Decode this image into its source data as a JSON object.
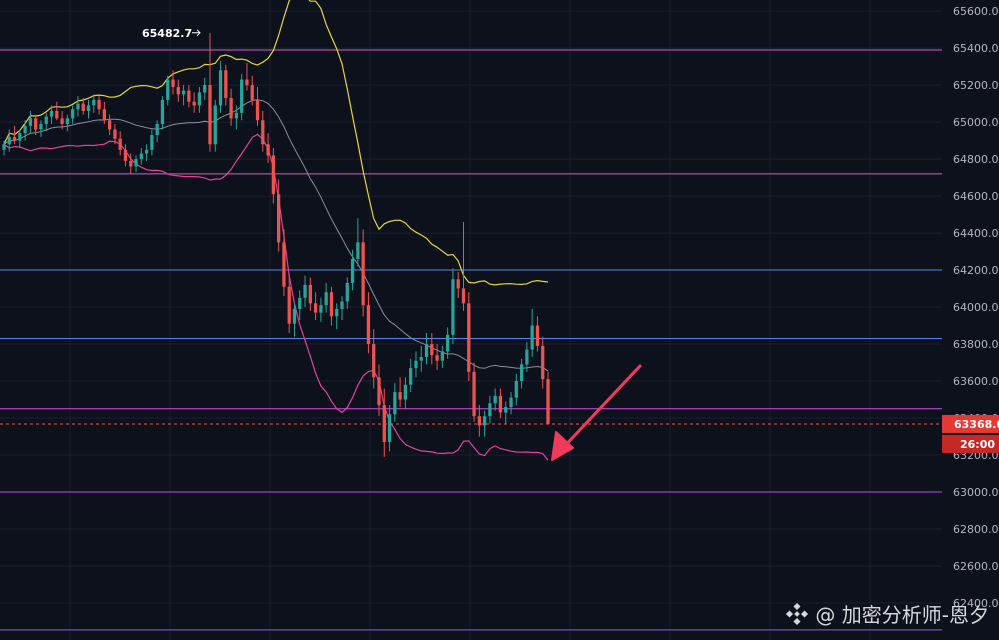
{
  "chart_data": {
    "type": "candlestick",
    "title": "",
    "ylim": [
      62200,
      65660
    ],
    "y_ticks": [
      "62400.0",
      "62600.0",
      "62800.0",
      "63000.0",
      "63200.0",
      "63400.0",
      "63600.0",
      "63800.0",
      "64000.0",
      "64200.0",
      "64400.0",
      "64600.0",
      "64800.0",
      "65000.0",
      "65200.0",
      "65400.0",
      "65600.0"
    ],
    "high_marker": {
      "label": "65482.7",
      "value": 65482.7
    },
    "last_price": {
      "label": "63368.0",
      "value": 63368.0
    },
    "countdown": "26:00",
    "levels": [
      {
        "value": 65390,
        "color": "#e256c8"
      },
      {
        "value": 64720,
        "color": "#e256c8"
      },
      {
        "value": 64200,
        "color": "#4f86f7"
      },
      {
        "value": 63830,
        "color": "#4f86f7"
      },
      {
        "value": 63450,
        "color": "#d24fe0"
      },
      {
        "value": 63000,
        "color": "#b94cf0"
      },
      {
        "value": 62255,
        "color": "#8b5cf6"
      }
    ],
    "candles": [
      [
        64850,
        64900,
        64820,
        64880
      ],
      [
        64880,
        64960,
        64840,
        64920
      ],
      [
        64920,
        64980,
        64880,
        64900
      ],
      [
        64900,
        64960,
        64860,
        64940
      ],
      [
        64940,
        65010,
        64900,
        64980
      ],
      [
        64980,
        65060,
        64940,
        65020
      ],
      [
        65020,
        65040,
        64930,
        64960
      ],
      [
        64960,
        65010,
        64920,
        64990
      ],
      [
        64990,
        65050,
        64950,
        65030
      ],
      [
        65030,
        65090,
        64990,
        65060
      ],
      [
        65060,
        65110,
        65010,
        65020
      ],
      [
        65020,
        65060,
        64960,
        64990
      ],
      [
        64990,
        65040,
        64950,
        65020
      ],
      [
        65020,
        65090,
        64990,
        65070
      ],
      [
        65070,
        65140,
        65030,
        65100
      ],
      [
        65100,
        65130,
        65040,
        65060
      ],
      [
        65060,
        65120,
        65020,
        65090
      ],
      [
        65090,
        65150,
        65050,
        65120
      ],
      [
        65120,
        65140,
        65040,
        65070
      ],
      [
        65070,
        65110,
        64990,
        65010
      ],
      [
        65010,
        65040,
        64930,
        64960
      ],
      [
        64960,
        64990,
        64880,
        64910
      ],
      [
        64910,
        64950,
        64820,
        64850
      ],
      [
        64850,
        64880,
        64760,
        64790
      ],
      [
        64790,
        64830,
        64720,
        64760
      ],
      [
        64760,
        64820,
        64730,
        64800
      ],
      [
        64800,
        64860,
        64770,
        64830
      ],
      [
        64830,
        64880,
        64790,
        64850
      ],
      [
        64850,
        64960,
        64820,
        64930
      ],
      [
        64930,
        65010,
        64890,
        64990
      ],
      [
        64990,
        65140,
        64960,
        65120
      ],
      [
        65120,
        65250,
        65090,
        65230
      ],
      [
        65230,
        65280,
        65150,
        65190
      ],
      [
        65190,
        65230,
        65110,
        65150
      ],
      [
        65150,
        65200,
        65090,
        65170
      ],
      [
        65170,
        65200,
        65080,
        65110
      ],
      [
        65110,
        65160,
        65050,
        65090
      ],
      [
        65090,
        65190,
        65050,
        65160
      ],
      [
        65160,
        65240,
        65120,
        65200
      ],
      [
        65200,
        65482,
        64840,
        64880
      ],
      [
        64880,
        65120,
        64840,
        65090
      ],
      [
        65090,
        65330,
        65050,
        65280
      ],
      [
        65280,
        65310,
        65090,
        65130
      ],
      [
        65130,
        65180,
        64980,
        65020
      ],
      [
        65020,
        65090,
        64960,
        65050
      ],
      [
        65050,
        65260,
        65010,
        65230
      ],
      [
        65230,
        65320,
        65170,
        65200
      ],
      [
        65200,
        65250,
        65090,
        65120
      ],
      [
        65120,
        65190,
        64980,
        65010
      ],
      [
        65010,
        65060,
        64840,
        64880
      ],
      [
        64880,
        64940,
        64780,
        64820
      ],
      [
        64820,
        64860,
        64560,
        64610
      ],
      [
        64610,
        64690,
        64300,
        64350
      ],
      [
        64350,
        64420,
        64060,
        64110
      ],
      [
        64110,
        64180,
        63860,
        63910
      ],
      [
        63910,
        64020,
        63840,
        63990
      ],
      [
        63990,
        64090,
        63930,
        64050
      ],
      [
        64050,
        64170,
        64000,
        64120
      ],
      [
        64120,
        64160,
        63980,
        64020
      ],
      [
        64020,
        64080,
        63930,
        63970
      ],
      [
        63970,
        64050,
        63920,
        64010
      ],
      [
        64010,
        64130,
        63970,
        64080
      ],
      [
        64080,
        64110,
        63900,
        63950
      ],
      [
        63950,
        64020,
        63880,
        63990
      ],
      [
        63990,
        64060,
        63930,
        64030
      ],
      [
        64030,
        64160,
        63990,
        64130
      ],
      [
        64130,
        64310,
        64090,
        64260
      ],
      [
        64260,
        64480,
        64220,
        64350
      ],
      [
        64350,
        64420,
        63950,
        64010
      ],
      [
        64010,
        64080,
        63750,
        63800
      ],
      [
        63800,
        63880,
        63560,
        63620
      ],
      [
        63620,
        63690,
        63410,
        63470
      ],
      [
        63470,
        63560,
        63190,
        63270
      ],
      [
        63270,
        63470,
        63220,
        63420
      ],
      [
        63420,
        63590,
        63380,
        63540
      ],
      [
        63540,
        63620,
        63460,
        63500
      ],
      [
        63500,
        63620,
        63450,
        63580
      ],
      [
        63580,
        63720,
        63540,
        63670
      ],
      [
        63670,
        63760,
        63620,
        63710
      ],
      [
        63710,
        63790,
        63650,
        63730
      ],
      [
        63730,
        63860,
        63690,
        63800
      ],
      [
        63800,
        63860,
        63690,
        63740
      ],
      [
        63740,
        63800,
        63660,
        63710
      ],
      [
        63710,
        63790,
        63670,
        63760
      ],
      [
        63760,
        63890,
        63720,
        63850
      ],
      [
        63850,
        64210,
        63800,
        64150
      ],
      [
        64150,
        64190,
        64050,
        64100
      ],
      [
        64100,
        64460,
        63980,
        64020
      ],
      [
        64020,
        64080,
        63600,
        63650
      ],
      [
        63650,
        63700,
        63380,
        63410
      ],
      [
        63410,
        63470,
        63300,
        63360
      ],
      [
        63360,
        63440,
        63300,
        63410
      ],
      [
        63410,
        63520,
        63370,
        63480
      ],
      [
        63480,
        63560,
        63440,
        63520
      ],
      [
        63520,
        63560,
        63400,
        63430
      ],
      [
        63430,
        63490,
        63370,
        63460
      ],
      [
        63460,
        63540,
        63420,
        63510
      ],
      [
        63510,
        63640,
        63470,
        63600
      ],
      [
        63600,
        63720,
        63560,
        63690
      ],
      [
        63690,
        63810,
        63650,
        63770
      ],
      [
        63770,
        63990,
        63730,
        63900
      ],
      [
        63900,
        63950,
        63760,
        63790
      ],
      [
        63790,
        63840,
        63560,
        63610
      ],
      [
        63610,
        63650,
        63368,
        63368
      ]
    ]
  },
  "watermark": {
    "handle": "@ 加密分析师-恩夕",
    "icon": "binance-diamond-icon"
  }
}
